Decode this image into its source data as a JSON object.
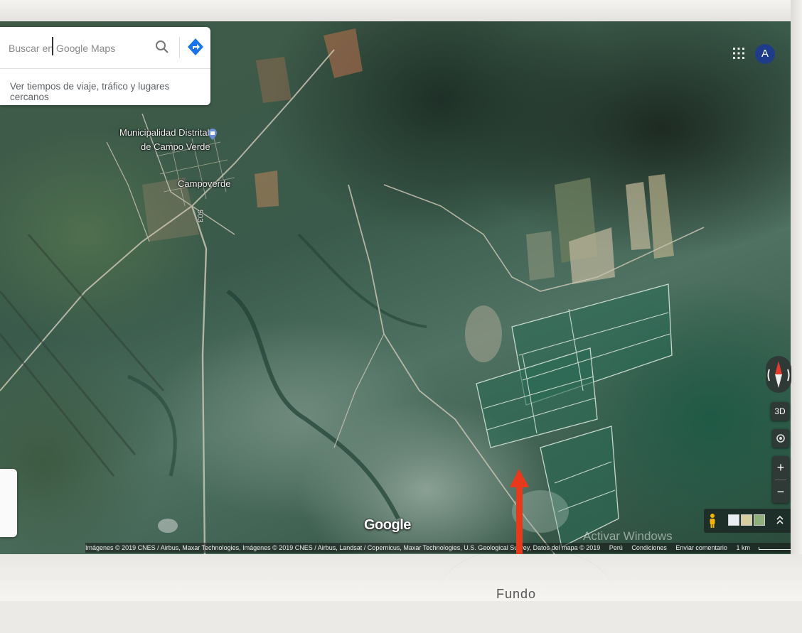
{
  "search": {
    "placeholder": "Buscar en Google Maps",
    "nearby_text": "Ver tiempos de viaje, tráfico y lugares cercanos"
  },
  "account": {
    "avatar_letter": "A"
  },
  "map_labels": {
    "municipality_line1": "Municipalidad Distrital",
    "municipality_line2": "de Campo Verde",
    "town": "Campoverde",
    "road_number": "503"
  },
  "controls": {
    "three_d": "3D",
    "zoom_in": "+",
    "zoom_out": "−",
    "expand": "⌃"
  },
  "branding": {
    "logo": "Google",
    "windows_watermark": "Activar Windows"
  },
  "attribution": {
    "imagery": "Imágenes © 2019 CNES / Airbus, Maxar Technologies, Imágenes © 2019 CNES / Airbus, Landsat / Copernicus, Maxar Technologies, U.S. Geological Survey, Datos del mapa © 2019",
    "country": "Perú",
    "terms": "Condiciones",
    "feedback": "Enviar comentario",
    "scale": "1 km"
  },
  "caption": "Fundo",
  "colors": {
    "arrow": "#e8391c",
    "avatar_bg": "#1f3c8a",
    "directions_blue": "#1a73e8"
  }
}
